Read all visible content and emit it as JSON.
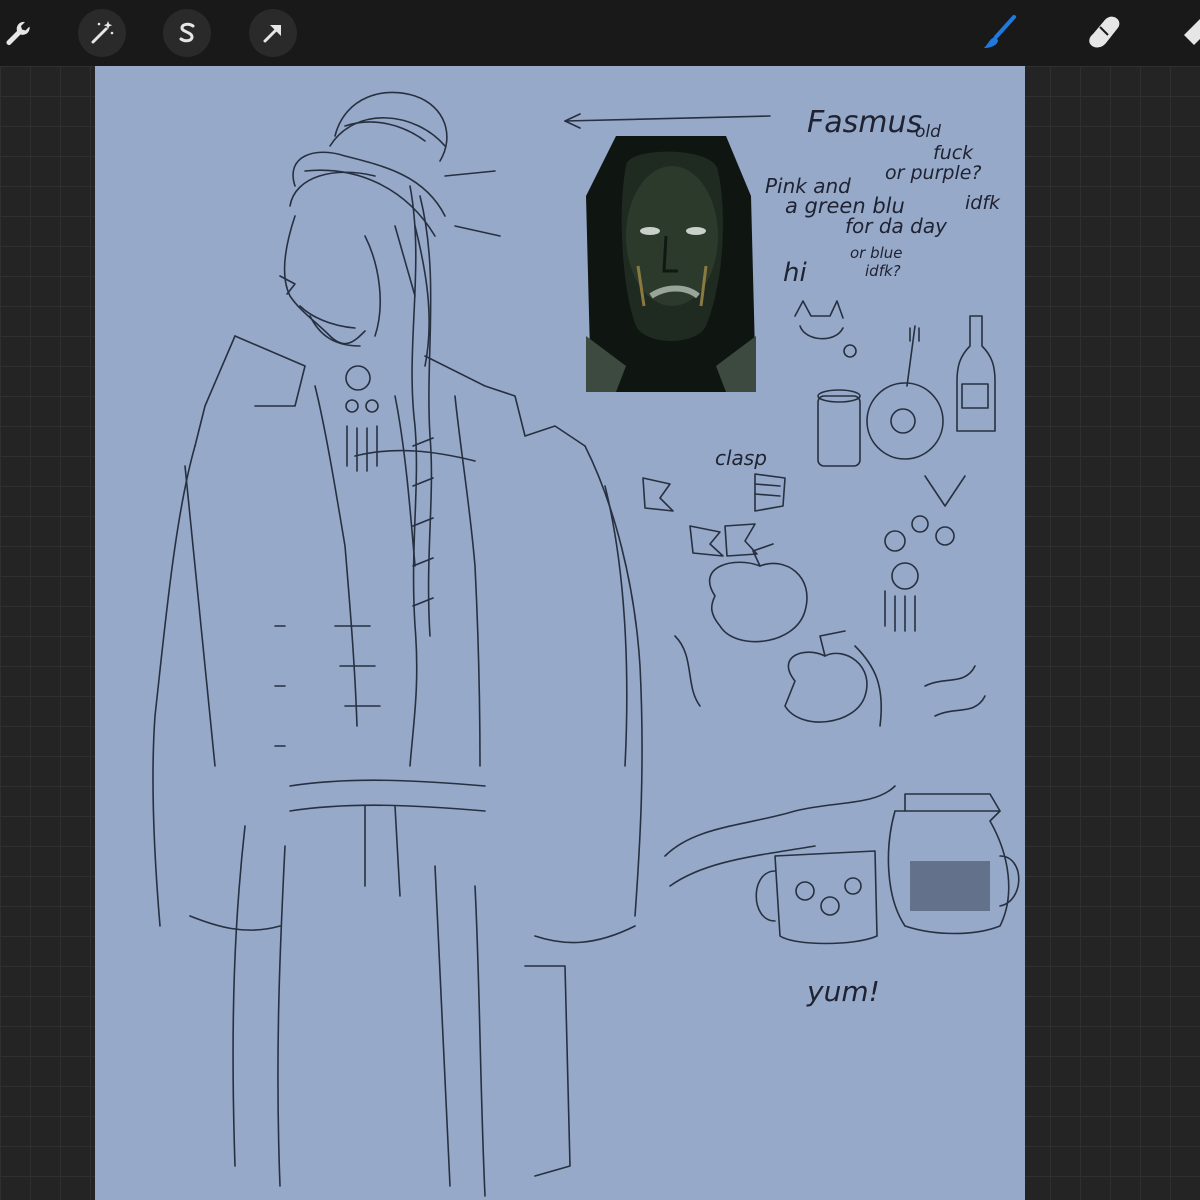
{
  "toolbar": {
    "left_tools": [
      {
        "name": "actions",
        "icon": "wrench-icon"
      },
      {
        "name": "adjustments",
        "icon": "magic-wand-icon"
      },
      {
        "name": "selection",
        "icon": "selection-s-icon"
      },
      {
        "name": "transform",
        "icon": "transform-arrow-icon"
      }
    ],
    "right_tools": [
      {
        "name": "brush",
        "icon": "brush-icon",
        "active": true
      },
      {
        "name": "smudge",
        "icon": "smudge-finger-icon",
        "active": false
      },
      {
        "name": "eraser",
        "icon": "eraser-icon",
        "active": false
      }
    ],
    "active_color": "#1f7ae0"
  },
  "canvas": {
    "background_color": "#97a9c9",
    "reference_image": "character-face-reference",
    "notes": {
      "name": "Fasmus",
      "old": "old",
      "fuck": "fuck",
      "or_purple": "or purple?",
      "pink_and": "Pink and",
      "green_blu": "a green blu",
      "for_da_day": "for da day",
      "idfk1": "idfk",
      "or_blue": "or blue",
      "idfk2": "idfk?",
      "hi": "hi",
      "clasp": "clasp",
      "yum": "yum!"
    }
  }
}
